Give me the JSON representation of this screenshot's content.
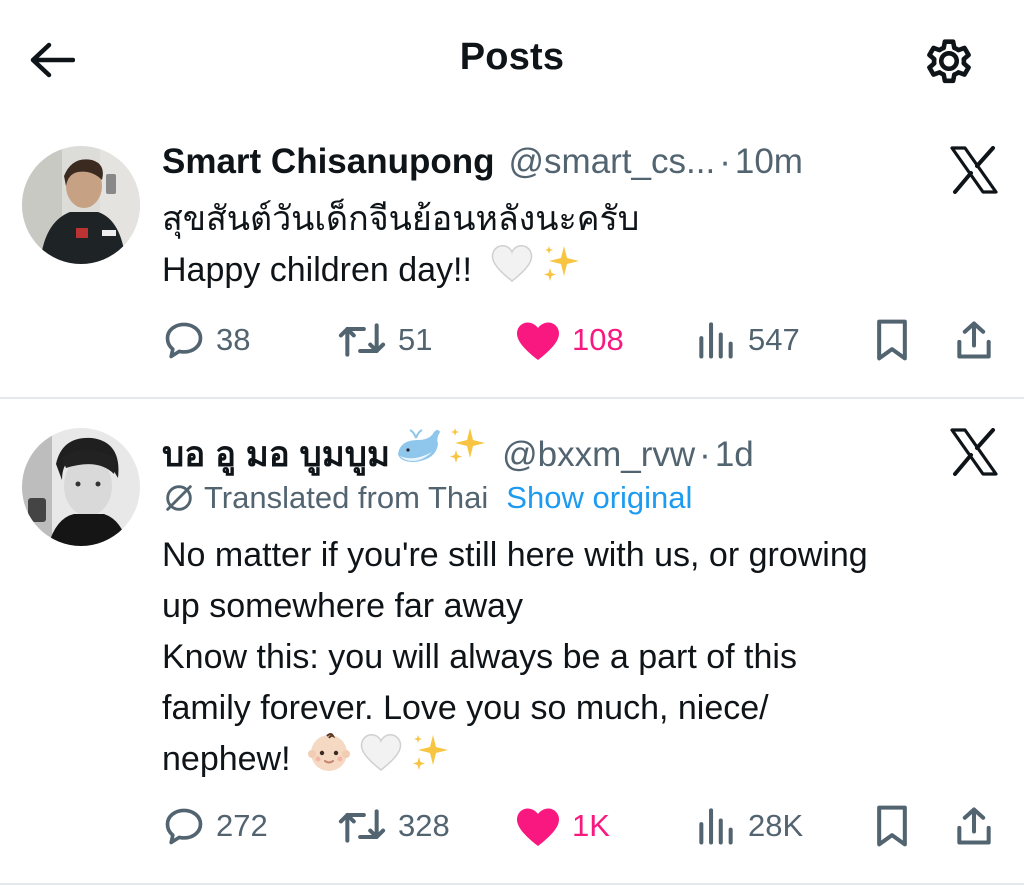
{
  "header": {
    "title": "Posts"
  },
  "posts": [
    {
      "author_name": "Smart Chisanupong",
      "handle": "@smart_cs...",
      "separator": "·",
      "time": "10m",
      "lines": [
        "สุขสันต์วันเด็กจีนย้อนหลังนะครับ",
        "Happy children day!!"
      ],
      "line2_emojis": [
        "white-heart",
        "sparkles"
      ],
      "stats": {
        "replies": "38",
        "reposts": "51",
        "likes": "108",
        "views": "547"
      },
      "liked": true
    },
    {
      "author_name": "บอ อู มอ บูมบูม",
      "name_emojis": [
        "whale",
        "sparkles"
      ],
      "handle": "@bxxm_rvw",
      "separator": "·",
      "time": "1d",
      "translation": {
        "label": "Translated from Thai",
        "link": "Show original"
      },
      "lines": [
        "No matter if you're still here with us, or growing",
        "up somewhere far away",
        "Know this: you will always be a part of this",
        "family forever. Love you so much, niece/",
        "nephew!"
      ],
      "last_line_emojis": [
        "baby",
        "white-heart",
        "sparkles"
      ],
      "stats": {
        "replies": "272",
        "reposts": "328",
        "likes": "1K",
        "views": "28K"
      },
      "liked": true
    }
  ],
  "colors": {
    "like": "#f91880",
    "link": "#1d9bf0",
    "muted": "#536471",
    "text": "#0f1419",
    "divider": "#e6e9eb"
  }
}
